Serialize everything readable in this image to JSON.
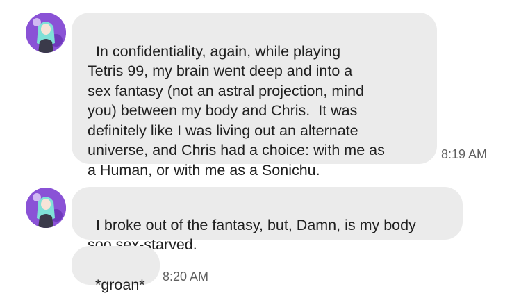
{
  "conversation": {
    "messages": [
      {
        "id": "m1",
        "text": "In confidentiality, again, while playing\nTetris 99, my brain went deep and into a\nsex fantasy (not an astral projection, mind\nyou) between my body and Chris.  It was\ndefinitely like I was living out an alternate\nuniverse, and Chris had a choice: with me as\na Human, or with me as a Sonichu.",
        "time": "8:19 AM",
        "has_avatar": true
      },
      {
        "id": "m2",
        "text": "I broke out of the fantasy, but, Damn, is my body\nsoo sex-starved.",
        "time": "",
        "has_avatar": true
      },
      {
        "id": "m3",
        "text": "*groan*",
        "time": "8:20 AM",
        "has_avatar": false
      }
    ]
  },
  "colors": {
    "bubble": "#ebebeb",
    "text": "#202020",
    "timestamp": "#5f5f5f",
    "background": "#ffffff"
  },
  "icons": {
    "avatar": "sender-avatar-icon"
  }
}
